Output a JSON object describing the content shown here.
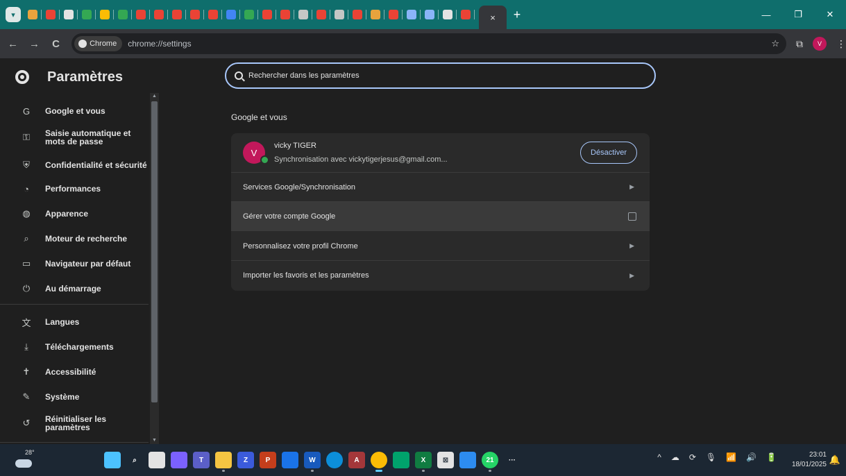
{
  "browser": {
    "tab_close": "×",
    "new_tab": "+",
    "window_controls": [
      "—",
      "❐",
      "✕"
    ],
    "nav": {
      "back": "←",
      "forward": "→",
      "reload": "C"
    },
    "omnibox": {
      "chip_label": "Chrome",
      "url": "chrome://settings",
      "star": "☆"
    },
    "profile_initial": "V",
    "menu": "⋮",
    "extensions": "⧉",
    "tab_favicon_colors": [
      "#e8a33d",
      "#ea4335",
      "#e3e3e3",
      "#34a853",
      "#fbbc05",
      "#34a853",
      "#ea4335",
      "#ea4335",
      "#ea4335",
      "#ea4335",
      "#ea4335",
      "#4285f4",
      "#34a853",
      "#ea4335",
      "#ea4335",
      "#c4c7c5",
      "#ea4335",
      "#c4c7c5",
      "#ea4335",
      "#e8a33d",
      "#ea4335",
      "#8ab4f8",
      "#8ab4f8",
      "#e3e3e3",
      "#ea4335"
    ]
  },
  "settings": {
    "title": "Paramètres",
    "search": {
      "placeholder": "Rechercher dans les paramètres"
    },
    "sidebar": {
      "items": [
        {
          "icon": "google-icon",
          "glyph": "G",
          "label": "Google et vous"
        },
        {
          "icon": "key-icon",
          "glyph": "⚿",
          "label": "Saisie automatique et\nmots de passe"
        },
        {
          "icon": "shield-icon",
          "glyph": "⛨",
          "label": "Confidentialité et sécurité"
        },
        {
          "icon": "speedometer-icon",
          "glyph": "◔",
          "label": "Performances"
        },
        {
          "icon": "palette-icon",
          "glyph": "◍",
          "label": "Apparence"
        },
        {
          "icon": "search-icon",
          "glyph": "⌕",
          "label": "Moteur de recherche"
        },
        {
          "icon": "browser-window-icon",
          "glyph": "▭",
          "label": "Navigateur par défaut"
        },
        {
          "icon": "power-icon",
          "glyph": "⏻",
          "label": "Au démarrage"
        },
        {
          "icon": "translate-icon",
          "glyph": "文",
          "label": "Langues"
        },
        {
          "icon": "download-icon",
          "glyph": "⤓",
          "label": "Téléchargements"
        },
        {
          "icon": "accessibility-icon",
          "glyph": "✝",
          "label": "Accessibilité"
        },
        {
          "icon": "wrench-icon",
          "glyph": "✎",
          "label": "Système"
        },
        {
          "icon": "reset-icon",
          "glyph": "↺",
          "label": "Réinitialiser les\nparamètres"
        }
      ]
    },
    "section": {
      "title": "Google et vous",
      "profile": {
        "initial": "V",
        "name": "vicky TIGER",
        "sync_text": "Synchronisation avec vickytigerjesus@gmail.com...",
        "button": "Désactiver"
      },
      "rows": [
        {
          "label": "Services Google/Synchronisation",
          "icon": "chevron-right-icon"
        },
        {
          "label": "Gérer votre compte Google",
          "icon": "external-link-icon"
        },
        {
          "label": "Personnalisez votre profil Chrome",
          "icon": "chevron-right-icon"
        },
        {
          "label": "Importer les favoris et les paramètres",
          "icon": "chevron-right-icon"
        }
      ]
    }
  },
  "taskbar": {
    "weather_temp": "28°",
    "apps": [
      {
        "name": "start",
        "color": "#4cc2ff",
        "glyph": ""
      },
      {
        "name": "search",
        "color": "transparent",
        "glyph": "⌕"
      },
      {
        "name": "task-view",
        "color": "#e3e3e3",
        "glyph": ""
      },
      {
        "name": "copilot",
        "color": "#7b61ff",
        "glyph": ""
      },
      {
        "name": "teams",
        "color": "#5b5fc7",
        "glyph": "T"
      },
      {
        "name": "file-explorer",
        "color": "#f4c542",
        "glyph": ""
      },
      {
        "name": "photo-app",
        "color": "#3b5bdb",
        "glyph": "Z"
      },
      {
        "name": "powerpoint",
        "color": "#c43e1c",
        "glyph": "P"
      },
      {
        "name": "app-blue",
        "color": "#1a73e8",
        "glyph": ""
      },
      {
        "name": "word",
        "color": "#185abd",
        "glyph": "W"
      },
      {
        "name": "edge",
        "color": "#0c8ed9",
        "glyph": ""
      },
      {
        "name": "access",
        "color": "#a4373a",
        "glyph": "A"
      },
      {
        "name": "chrome",
        "color": "#fbbc05",
        "glyph": ""
      },
      {
        "name": "app-green",
        "color": "#00a36c",
        "glyph": ""
      },
      {
        "name": "excel",
        "color": "#107c41",
        "glyph": "X"
      },
      {
        "name": "app-mono",
        "color": "#e3e3e3",
        "glyph": "⊠"
      },
      {
        "name": "photos",
        "color": "#2d8cf0",
        "glyph": ""
      },
      {
        "name": "whatsapp",
        "color": "#25d366",
        "glyph": "21"
      },
      {
        "name": "more",
        "color": "transparent",
        "glyph": "···"
      }
    ],
    "tray_icons": [
      "^",
      "☁",
      "⟳",
      "🎙",
      "📶",
      "🔊",
      "🔋"
    ],
    "time": "23:01",
    "date": "18/01/2025",
    "notification": "🔔"
  }
}
